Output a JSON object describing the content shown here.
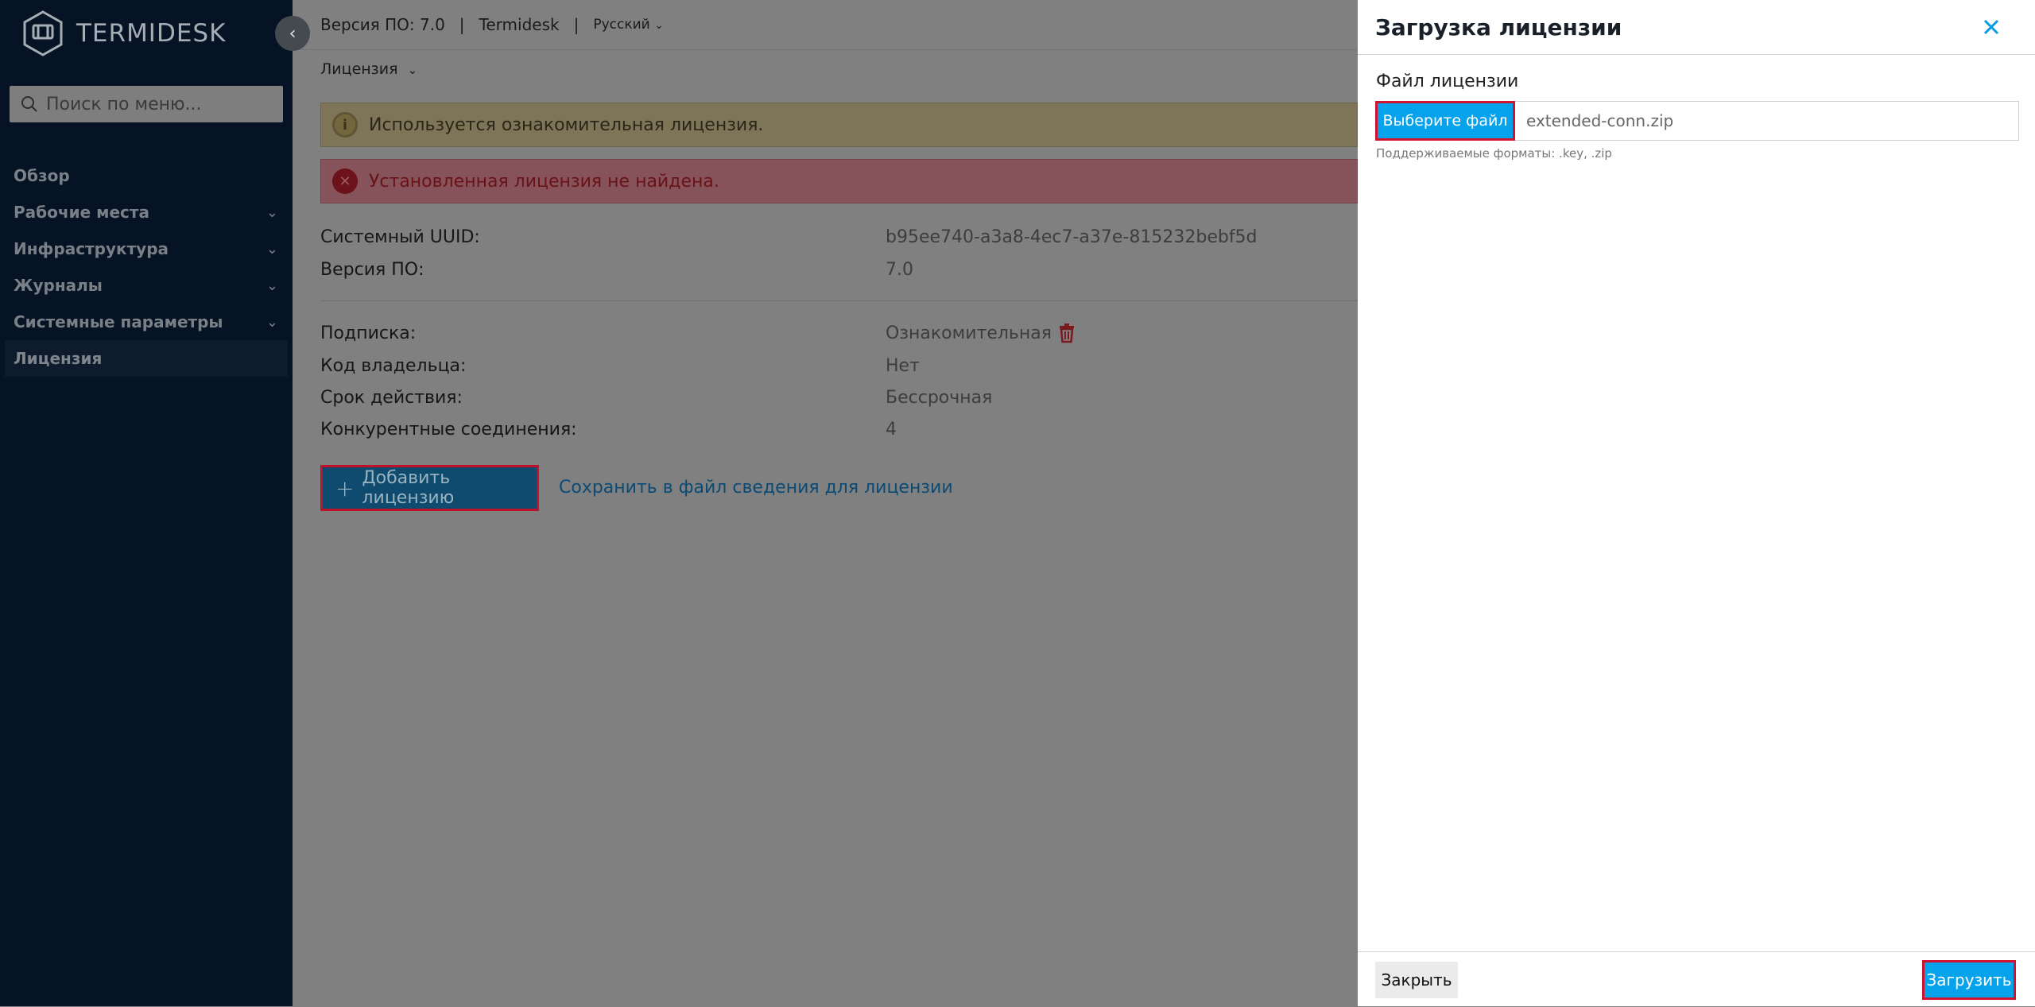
{
  "app": {
    "logo_text": "TERMIDESK"
  },
  "sidebar": {
    "search_placeholder": "Поиск по меню...",
    "items": [
      {
        "label": "Обзор",
        "has_children": false
      },
      {
        "label": "Рабочие места",
        "has_children": true
      },
      {
        "label": "Инфраструктура",
        "has_children": true
      },
      {
        "label": "Журналы",
        "has_children": true
      },
      {
        "label": "Системные параметры",
        "has_children": true
      },
      {
        "label": "Лицензия",
        "has_children": false,
        "active": true
      }
    ]
  },
  "topbar": {
    "version": "Версия ПО: 7.0",
    "separator": "|",
    "product": "Termidesk",
    "language": "Русский"
  },
  "breadcrumb": {
    "label": "Лицензия"
  },
  "alerts": {
    "warning": "Используется ознакомительная лицензия.",
    "error": "Установленная лицензия не найдена."
  },
  "system_info": [
    {
      "label": "Системный UUID:",
      "value": "b95ee740-a3a8-4ec7-a37e-815232bebf5d"
    },
    {
      "label": "Версия ПО:",
      "value": "7.0"
    }
  ],
  "license_info": [
    {
      "label": "Подписка:",
      "value": "Ознакомительная"
    },
    {
      "label": "Код владельца:",
      "value": "Нет"
    },
    {
      "label": "Срок действия:",
      "value": "Бессрочная"
    },
    {
      "label": "Конкурентные соединения:",
      "value": "4"
    }
  ],
  "actions": {
    "add_license": "Добавить лицензию",
    "save_info": "Сохранить в файл сведения для лицензии"
  },
  "drawer": {
    "title": "Загрузка лицензии",
    "field_label": "Файл лицензии",
    "choose_button": "Выберите файл",
    "file_name": "extended-conn.zip",
    "hint": "Поддерживаемые форматы: .key, .zip",
    "close_button": "Закрыть",
    "upload_button": "Загрузить"
  },
  "colors": {
    "sidebar_bg": "#061324",
    "primary": "#06a3ec",
    "highlight_border": "#d0142f"
  }
}
